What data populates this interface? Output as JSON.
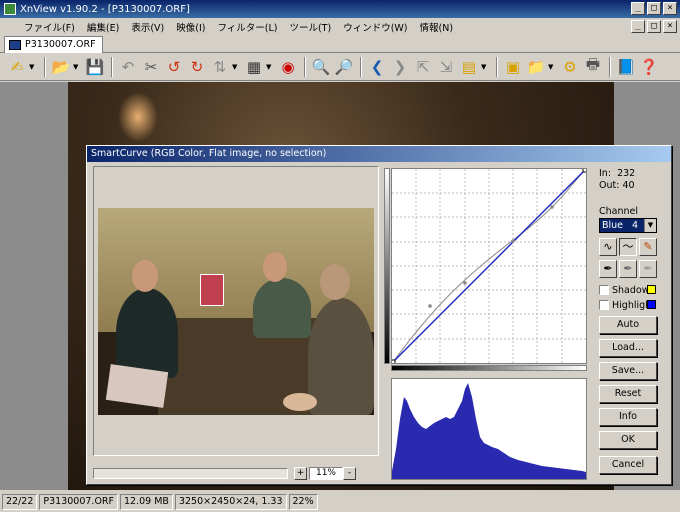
{
  "window": {
    "title": "XnView v1.90.2 - [P3130007.ORF]",
    "min": "_",
    "max": "□",
    "close": "×"
  },
  "menu": {
    "items": [
      "ファイル(F)",
      "編集(E)",
      "表示(V)",
      "映像(I)",
      "フィルター(L)",
      "ツール(T)",
      "ウィンドウ(W)",
      "情報(N)"
    ]
  },
  "tab": {
    "label": "P3130007.ORF"
  },
  "status": {
    "index": "22/22",
    "filename": "P3130007.ORF",
    "filesize": "12.09 MB",
    "dimensions": "3250×2450×24, 1.33",
    "zoom": "22%"
  },
  "dialog": {
    "title": "SmartCurve (RGB Color, Flat image, no selection)",
    "zoom_value": "11%",
    "zoom_plus": "+",
    "zoom_minus": "-",
    "in_label": "In:",
    "in_value": "232",
    "out_label": "Out:",
    "out_value": "40",
    "channel_label": "Channel",
    "channel_value": "Blue",
    "channel_num": "4",
    "shadow_label": "Shadow",
    "highlight_label": "Highlight",
    "buttons": {
      "auto": "Auto",
      "load": "Load...",
      "save": "Save...",
      "reset": "Reset",
      "info": "Info",
      "ok": "OK",
      "cancel": "Cancel"
    }
  },
  "colors": {
    "titlebar": "#0a246a",
    "shadow_swatch": "#ffff00",
    "highlight_swatch": "#0000ff",
    "curve_blue": "#2222cc",
    "histogram_fill": "#2a2ab0"
  }
}
